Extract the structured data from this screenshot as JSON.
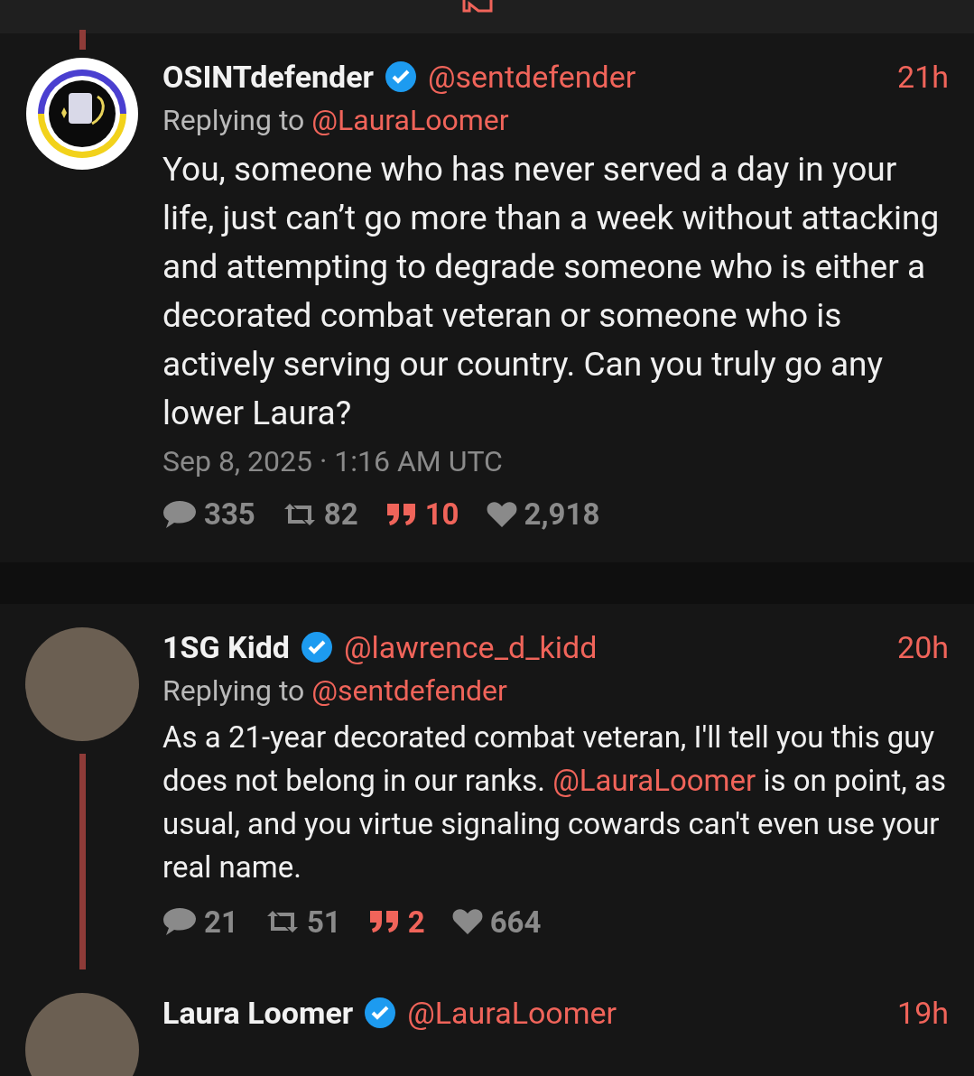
{
  "tweets": [
    {
      "kind": "main",
      "name": "OSINTdefender",
      "verified": true,
      "handle": "@sentdefender",
      "time": "21h",
      "avatar": {
        "kind": "logo"
      },
      "thread_above": true,
      "thread_below": false,
      "replying_label": "Replying to",
      "replying_to": "@LauraLoomer",
      "body": [
        {
          "kind": "text",
          "text": "You, someone who has never served a day in your life, just can’t go more than a week without attacking and attempting to degrade someone who is either a decorated combat veteran or someone who is actively serving our country. Can you truly go any lower Laura?"
        }
      ],
      "date": "Sep 8, 2025 · 1:16 AM UTC",
      "stats": [
        {
          "kind": "reply",
          "value": "335"
        },
        {
          "kind": "retweet",
          "value": "82"
        },
        {
          "kind": "quote",
          "value": "10"
        },
        {
          "kind": "like",
          "value": "2,918"
        }
      ]
    },
    {
      "kind": "reply",
      "name": "1SG Kidd",
      "verified": true,
      "handle": "@lawrence_d_kidd",
      "time": "20h",
      "avatar": {
        "kind": "photo"
      },
      "thread_above": false,
      "thread_below": true,
      "replying_label": "Replying to",
      "replying_to": "@sentdefender",
      "body": [
        {
          "kind": "text",
          "text": "As a 21-year decorated combat veteran, I'll tell you this guy does not belong in our ranks. "
        },
        {
          "kind": "mention",
          "text": "@LauraLoomer"
        },
        {
          "kind": "text",
          "text": " is on point, as usual, and you virtue signaling cowards can't even use your real name."
        }
      ],
      "stats": [
        {
          "kind": "reply",
          "value": "21"
        },
        {
          "kind": "retweet",
          "value": "51"
        },
        {
          "kind": "quote",
          "value": "2"
        },
        {
          "kind": "like",
          "value": "664"
        }
      ]
    },
    {
      "kind": "reply",
      "name": "Laura Loomer",
      "verified": true,
      "handle": "@LauraLoomer",
      "time": "19h",
      "avatar": {
        "kind": "photo"
      },
      "thread_above": false,
      "thread_below": false
    }
  ]
}
